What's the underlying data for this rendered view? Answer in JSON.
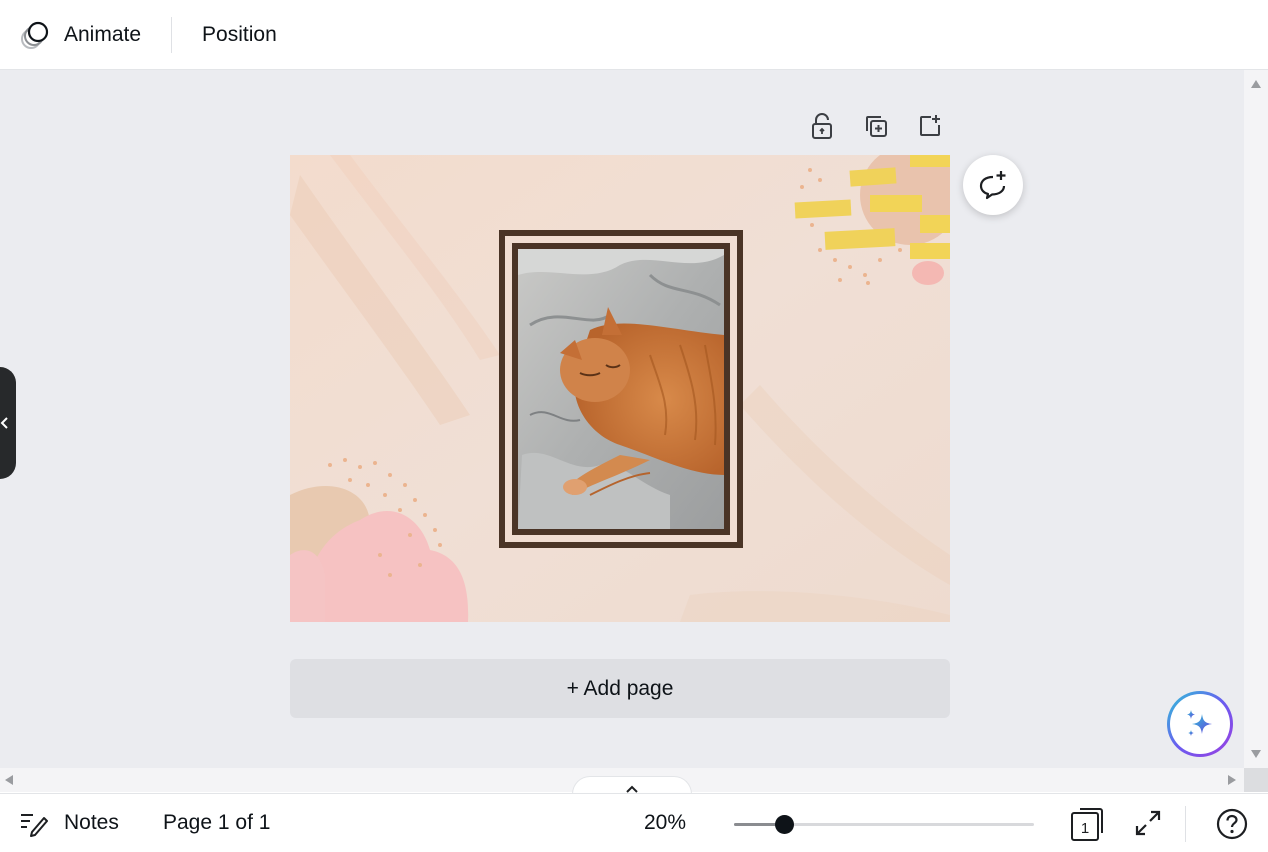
{
  "toolbar": {
    "animate_label": "Animate",
    "position_label": "Position"
  },
  "canvas": {
    "page_tool_icons": [
      "unlock-icon",
      "duplicate-page-icon",
      "add-page-icon"
    ],
    "comment_icon": "add-comment-icon",
    "add_page_label": "+ Add page",
    "design": {
      "background_color": "#f0ddd2",
      "frame_color": "#4a3426",
      "photo_subject": "sleeping orange tabby cat on grey bedsheets"
    }
  },
  "bottom_bar": {
    "notes_label": "Notes",
    "page_indicator": "Page 1 of 1",
    "zoom_label": "20%",
    "zoom_value_percent": 20,
    "page_count": "1"
  },
  "colors": {
    "accent_gradient": [
      "#2ec4d6",
      "#6a5cf0",
      "#9b3fe0"
    ],
    "workspace": "#ebecf0"
  }
}
